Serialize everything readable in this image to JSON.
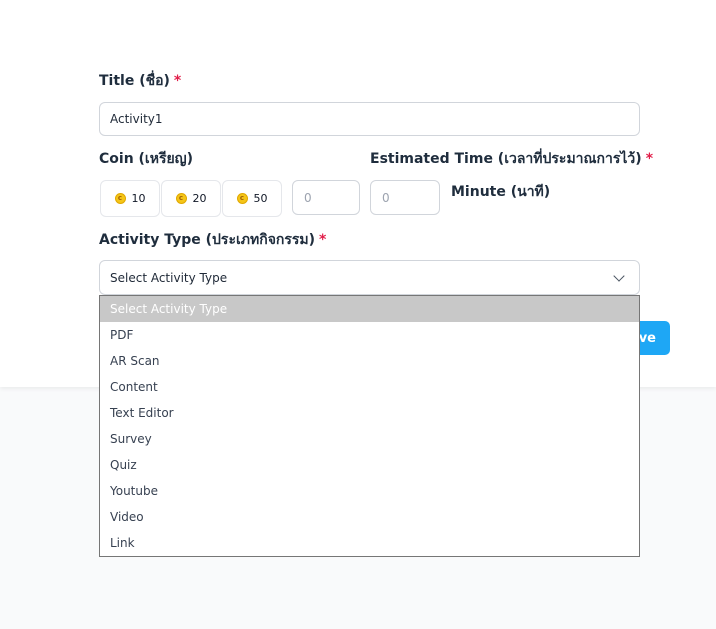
{
  "form": {
    "title_label": "Title (ชื่อ)",
    "title_required": "*",
    "title_value": "Activity1",
    "coin_label": "Coin (เหรียญ)",
    "coin_icon": "coin-icon",
    "coin_icon_glyph": "c",
    "coin_options": [
      "10",
      "20",
      "50"
    ],
    "coin_input_placeholder": "0",
    "time_label": "Estimated Time (เวลาที่ประมาณการไว้)",
    "time_required": "*",
    "time_input_placeholder": "0",
    "time_unit": "Minute (นาที)",
    "type_label": "Activity Type (ประเภทกิจกรรม)",
    "type_required": "*",
    "type_selected": "Select Activity Type",
    "save_label": "ave"
  },
  "dropdown": {
    "options": [
      "Select Activity Type",
      "PDF",
      "AR Scan",
      "Content",
      "Text Editor",
      "Survey",
      "Quiz",
      "Youtube",
      "Video",
      "Link"
    ],
    "highlighted_index": 0
  },
  "colors": {
    "required": "#e11d48",
    "save_button": "#1ea7f5",
    "coin": "#f5c518",
    "highlight": "#c8c8c8"
  }
}
